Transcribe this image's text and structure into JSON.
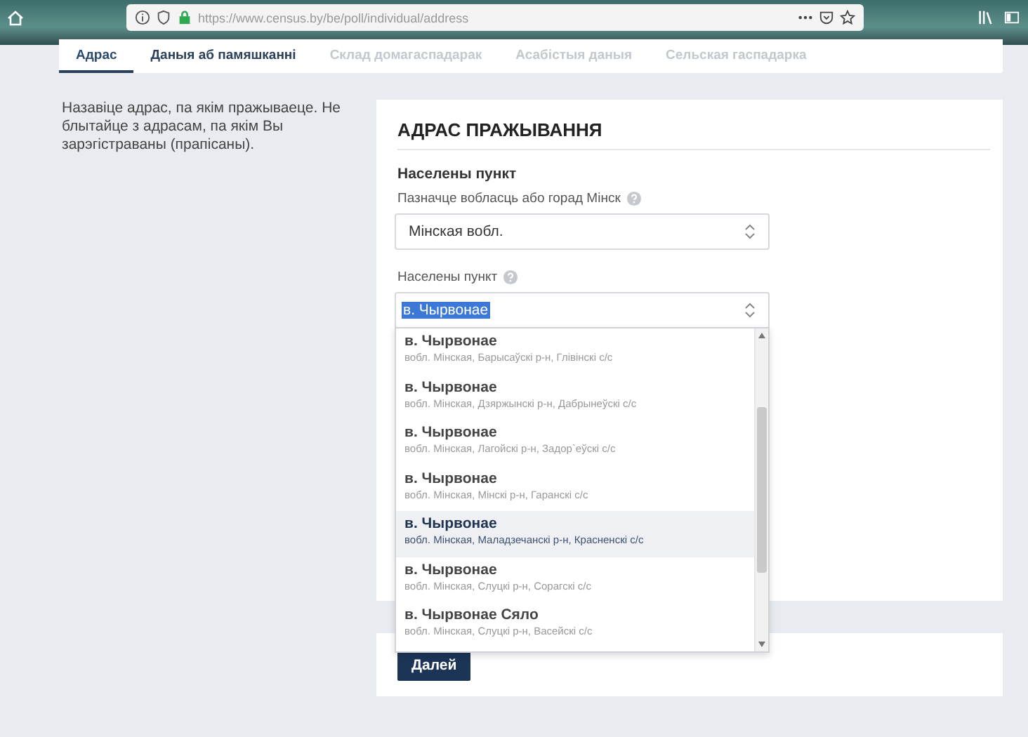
{
  "browser": {
    "url": "https://www.census.by/be/poll/individual/address"
  },
  "tabs": [
    {
      "label": "Адрас",
      "selected": true,
      "disabled": false
    },
    {
      "label": "Даныя аб памяшканні",
      "selected": false,
      "disabled": false
    },
    {
      "label": "Склад домагаспадарак",
      "selected": false,
      "disabled": true
    },
    {
      "label": "Асабістыя даныя",
      "selected": false,
      "disabled": true
    },
    {
      "label": "Сельская гаспадарка",
      "selected": false,
      "disabled": true
    }
  ],
  "hint": "Назавіце адрас, па якім пражываеце. Не блытайце з адрасам, па якім Вы зарэгістраваны (прапісаны).",
  "form": {
    "title": "АДРАС ПРАЖЫВАННЯ",
    "section": "Населены пункт",
    "region": {
      "label": "Пазначце вобласць або горад Мінск",
      "value": "Мінская вобл."
    },
    "locality": {
      "label": "Населены пункт",
      "value": "в. Чырвонае",
      "expanded": true,
      "options": [
        {
          "name": "в. Чырвонае",
          "detail": "вобл. Мінская, Барысаўскі р-н, Глівінскі с/с",
          "highlighted": false
        },
        {
          "name": "в. Чырвонае",
          "detail": "вобл. Мінская, Дзяржынскі р-н, Дабрынеўскі с/с",
          "highlighted": false
        },
        {
          "name": "в. Чырвонае",
          "detail": "вобл. Мінская, Лагойскі р-н, Задор`еўскі с/с",
          "highlighted": false
        },
        {
          "name": "в. Чырвонае",
          "detail": "вобл. Мінская, Мінскі р-н, Гаранскі с/с",
          "highlighted": false
        },
        {
          "name": "в. Чырвонае",
          "detail": "вобл. Мінская, Маладзечанскі р-н, Красненскі с/с",
          "highlighted": true
        },
        {
          "name": "в. Чырвонае",
          "detail": "вобл. Мінская, Слуцкі р-н, Сорагскі с/с",
          "highlighted": false
        },
        {
          "name": "в. Чырвонае Сяло",
          "detail": "вобл. Мінская, Слуцкі р-н, Васейскі с/с",
          "highlighted": false
        }
      ]
    }
  },
  "next_button": "Далей"
}
